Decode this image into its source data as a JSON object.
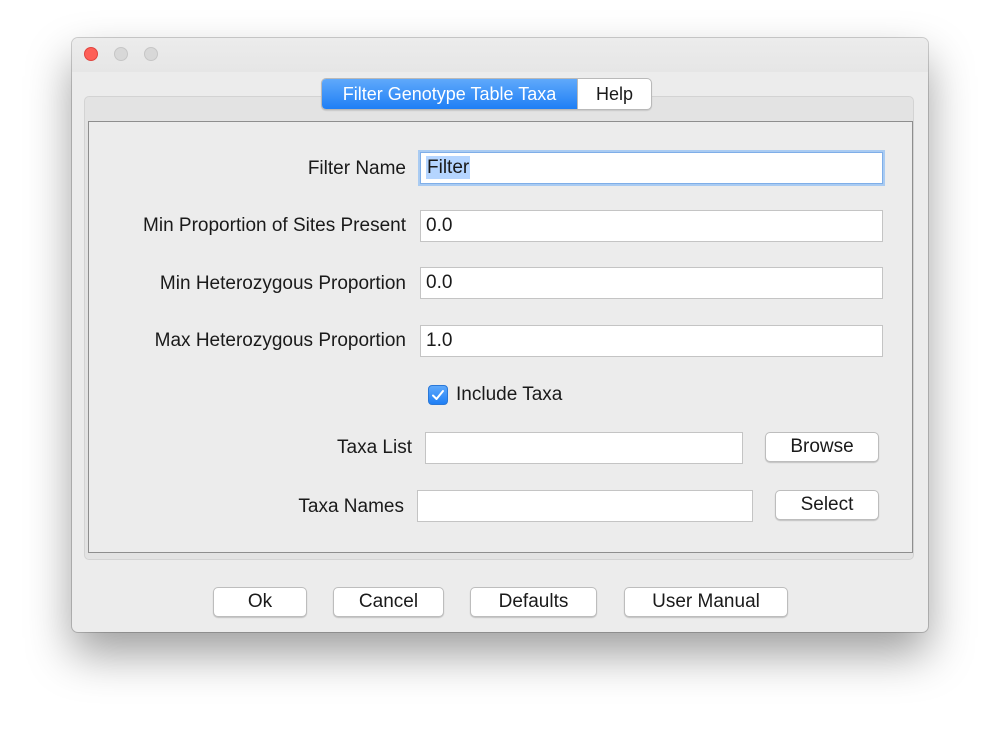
{
  "tabs": [
    {
      "label": "Filter Genotype Table Taxa",
      "selected": true
    },
    {
      "label": "Help",
      "selected": false
    }
  ],
  "form": {
    "filter_name": {
      "label": "Filter Name",
      "value": "Filter"
    },
    "min_sites_present": {
      "label": "Min Proportion of Sites Present",
      "value": "0.0"
    },
    "min_het": {
      "label": "Min Heterozygous Proportion",
      "value": "0.0"
    },
    "max_het": {
      "label": "Max Heterozygous Proportion",
      "value": "1.0"
    },
    "include_taxa": {
      "label": "Include Taxa",
      "checked": true
    },
    "taxa_list": {
      "label": "Taxa List",
      "value": "",
      "button": "Browse"
    },
    "taxa_names": {
      "label": "Taxa Names",
      "value": "",
      "button": "Select"
    }
  },
  "footer": {
    "ok": "Ok",
    "cancel": "Cancel",
    "defaults": "Defaults",
    "user_manual": "User Manual"
  },
  "colors": {
    "accent": "#1f7ff5",
    "close_button": "#fe5f57",
    "selection": "#b5d5ff"
  },
  "icons": {
    "close": "close-icon",
    "minimize": "minimize-icon",
    "zoom": "zoom-icon",
    "checkmark": "checkmark-icon"
  }
}
